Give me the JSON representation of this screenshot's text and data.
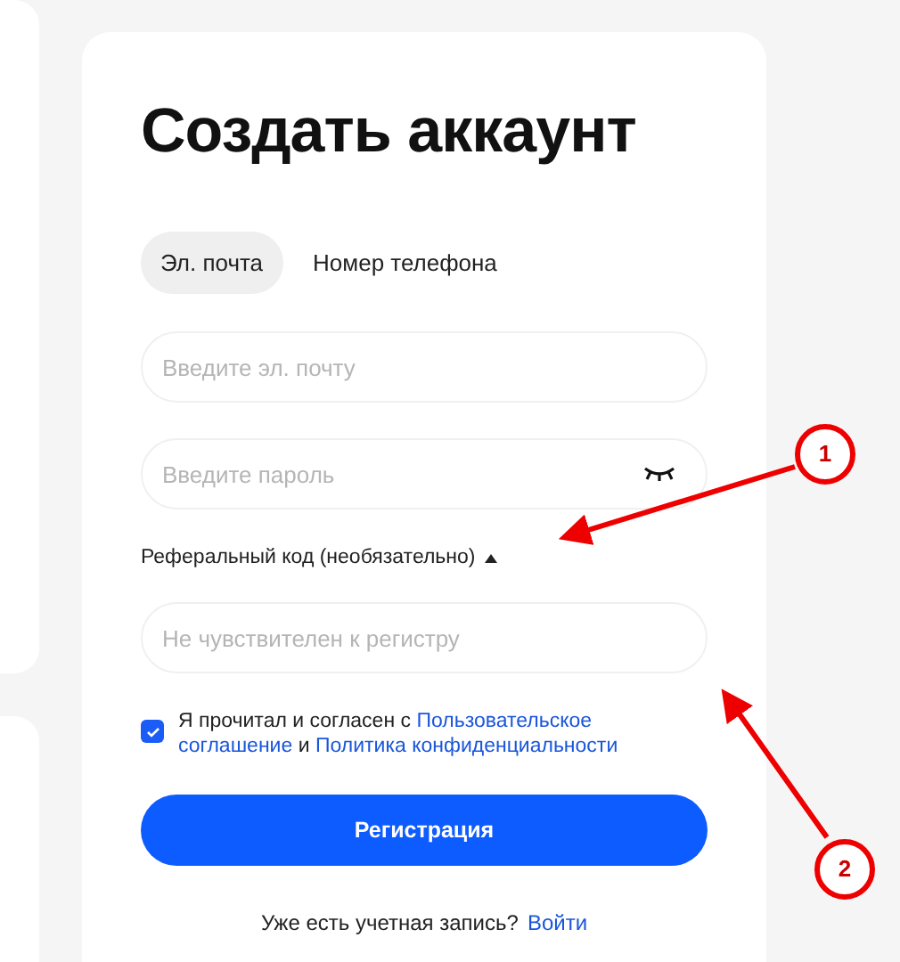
{
  "title": "Создать аккаунт",
  "tabs": [
    {
      "label": "Эл. почта",
      "selected": true
    },
    {
      "label": "Номер телефона",
      "selected": false
    }
  ],
  "email_field": {
    "placeholder": "Введите эл. почту"
  },
  "password_field": {
    "placeholder": "Введите пароль"
  },
  "referral": {
    "label": "Реферальный код (необязательно)",
    "expanded": true,
    "placeholder": "Не чувствителен к регистру"
  },
  "agreement": {
    "checked": true,
    "text": "Я прочитал и согласен с",
    "link_1_first_line": "Пользовательское",
    "link_1_second_line": "соглашение",
    "joiner": "и",
    "link_2": "Политика конфиденциальности"
  },
  "register_button": "Регистрация",
  "footer": {
    "text": "Уже есть учетная запись?",
    "link": "Войти"
  },
  "annotations": [
    {
      "label": "1"
    },
    {
      "label": "2"
    }
  ]
}
